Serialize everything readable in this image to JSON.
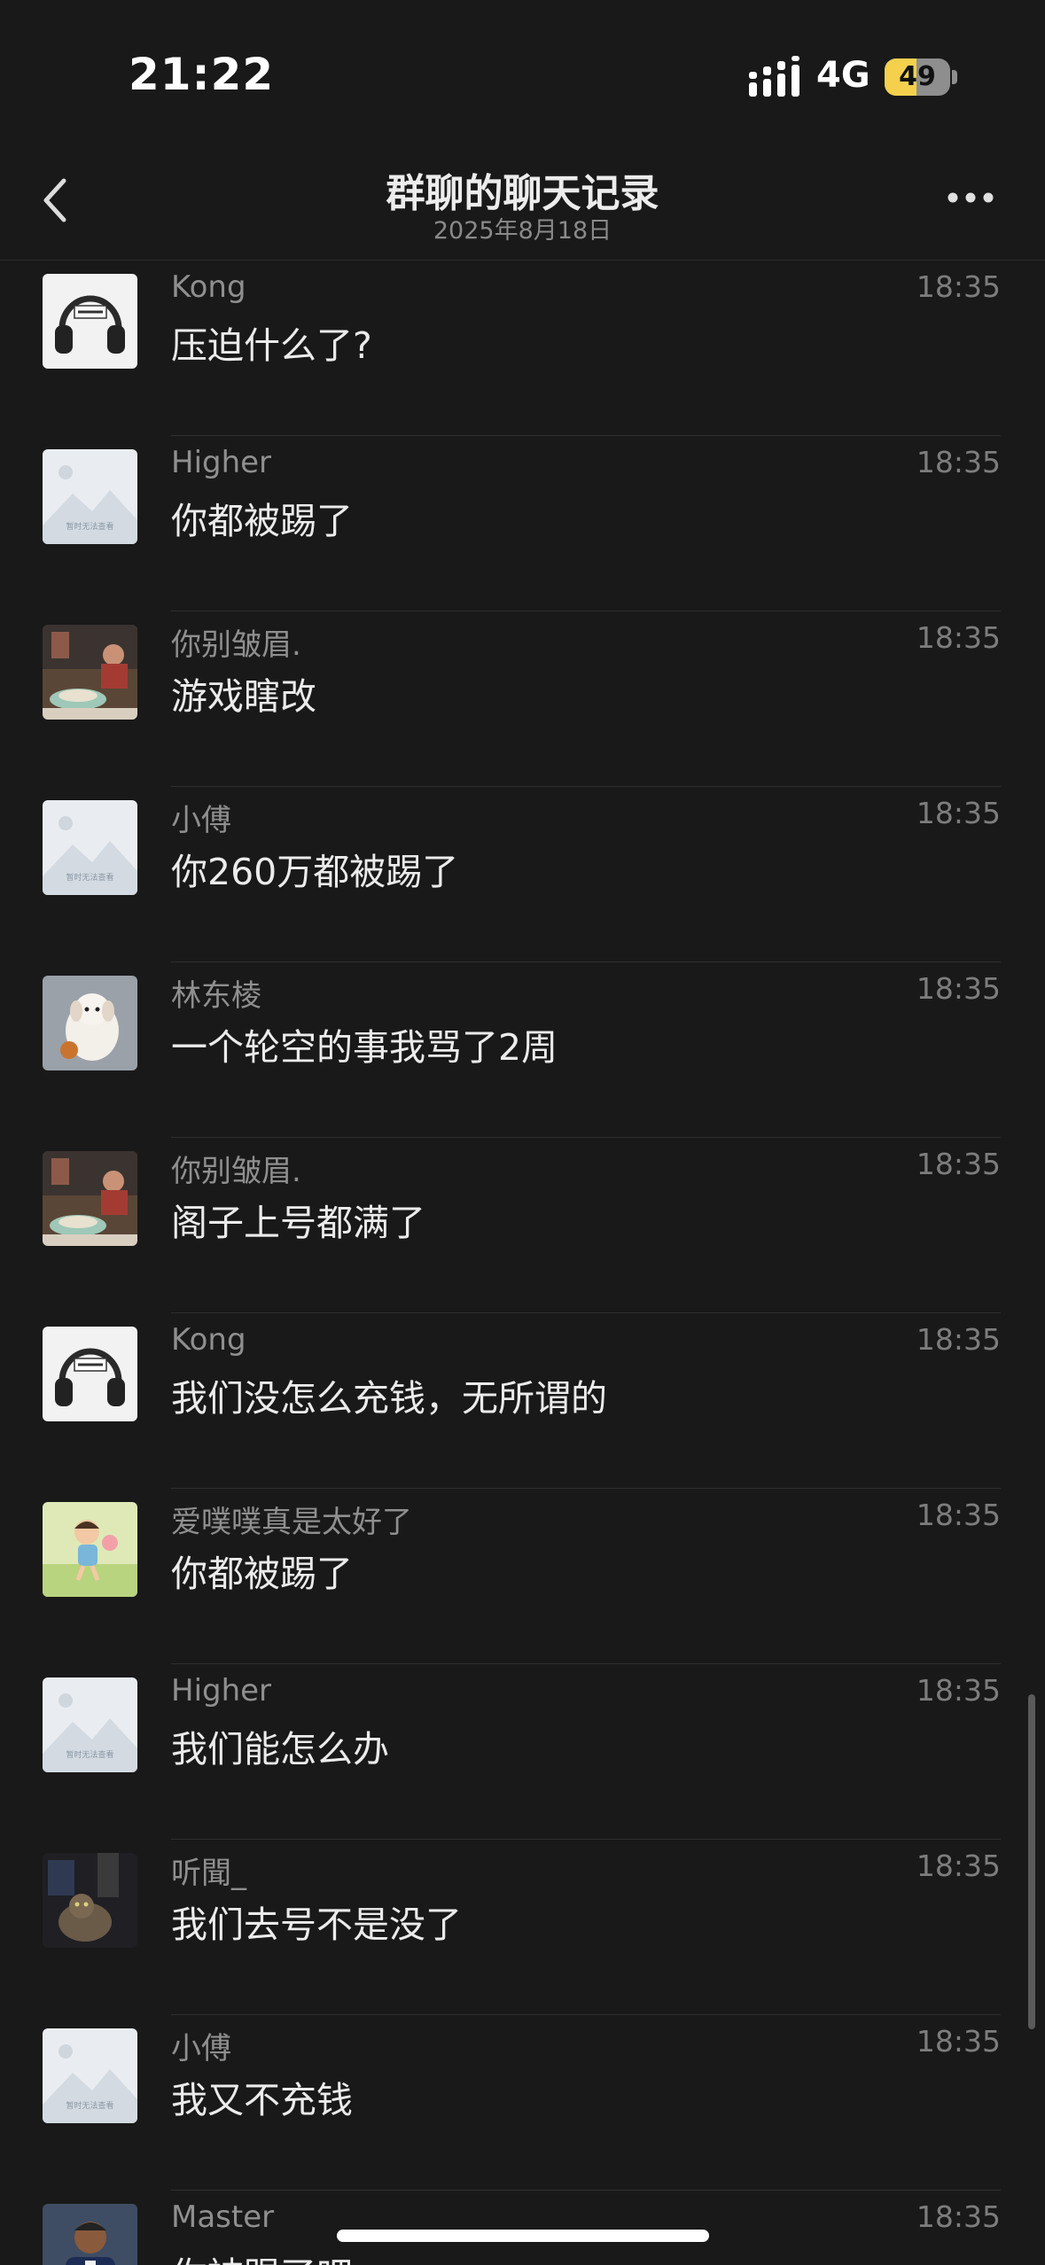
{
  "status_bar": {
    "time": "21:22",
    "network": "4G",
    "battery_level": "49",
    "battery_fraction": 0.49
  },
  "nav": {
    "title": "群聊的聊天记录",
    "subtitle": "2025年8月18日",
    "back_icon": "chevron-left-icon",
    "more_icon": "ellipsis-icon"
  },
  "messages": [
    {
      "sender": "Kong",
      "time": "18:35",
      "text": "压迫什么了?",
      "avatar": "headphones"
    },
    {
      "sender": "Higher",
      "time": "18:35",
      "text": "你都被踢了",
      "avatar": "placeholder"
    },
    {
      "sender": "你别皱眉.",
      "time": "18:35",
      "text": "游戏瞎改",
      "avatar": "photo-table"
    },
    {
      "sender": "小傅",
      "time": "18:35",
      "text": "你260万都被踢了",
      "avatar": "placeholder"
    },
    {
      "sender": "林东棱",
      "time": "18:35",
      "text": "一个轮空的事我骂了2周",
      "avatar": "puppy"
    },
    {
      "sender": "你别皱眉.",
      "time": "18:35",
      "text": "阁子上号都满了",
      "avatar": "photo-table"
    },
    {
      "sender": "Kong",
      "time": "18:35",
      "text": "我们没怎么充钱，无所谓的",
      "avatar": "headphones"
    },
    {
      "sender": "爱噗噗真是太好了",
      "time": "18:35",
      "text": "你都被踢了",
      "avatar": "cartoon-kid"
    },
    {
      "sender": "Higher",
      "time": "18:35",
      "text": "我们能怎么办",
      "avatar": "placeholder"
    },
    {
      "sender": "听聞_",
      "time": "18:35",
      "text": "我们去号不是没了",
      "avatar": "cat-night"
    },
    {
      "sender": "小傅",
      "time": "18:35",
      "text": "我又不充钱",
      "avatar": "placeholder"
    },
    {
      "sender": "Master",
      "time": "18:35",
      "text": "你被踢了吧",
      "avatar": "footballer"
    }
  ],
  "placeholder_avatar_caption": "暂时无法查看",
  "colors": {
    "background": "#191919",
    "text_primary": "#ebebeb",
    "text_secondary": "#8f8f8f",
    "battery_accent": "#f4d04d"
  }
}
